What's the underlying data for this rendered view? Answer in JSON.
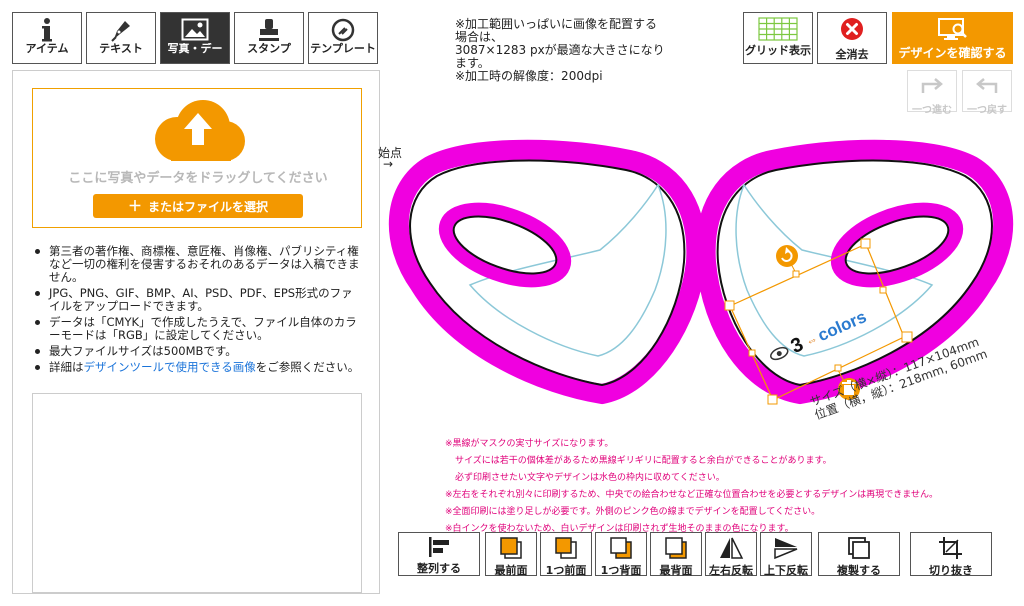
{
  "tabs": [
    {
      "label": "アイテム",
      "icon": "info-icon"
    },
    {
      "label": "テキスト",
      "icon": "pen-icon"
    },
    {
      "label": "写真・デー",
      "icon": "image-icon",
      "active": true
    },
    {
      "label": "スタンプ",
      "icon": "stamp-icon"
    },
    {
      "label": "テンプレート",
      "icon": "template-icon"
    }
  ],
  "upload": {
    "drop_text": "ここに写真やデータをドラッグしてください",
    "select_button": "またはファイルを選択"
  },
  "notes": [
    "第三者の著作権、商標権、意匠権、肖像権、パブリシティ権など一切の権利を侵害するおそれのあるデータは入稿できません。",
    "JPG、PNG、GIF、BMP、AI、PSD、PDF、EPS形式のファイルをアップロードできます。",
    "データは「CMYK」で作成したうえで、ファイル自体のカラーモードは「RGB」に設定してください。",
    "最大ファイルサイズは500MBです。"
  ],
  "note_link": {
    "prefix": "詳細は",
    "link": "デザインツールで使用できる画像",
    "suffix": "をご参照ください。"
  },
  "info": {
    "line1": "※加工範囲いっぱいに画像を配置する",
    "line2": "場合は、",
    "line3": "3087×1283 pxが最適な大きさになり",
    "line4": "ます。",
    "line5": "※加工時の解像度：200dpi"
  },
  "top_buttons": {
    "grid": "グリッド表示",
    "clear": "全消去",
    "confirm": "デザインを確認する",
    "redo": "一つ進む",
    "undo": "一つ戻す"
  },
  "canvas": {
    "start_label": "始点",
    "start_arrow": "→",
    "logo_text": "3",
    "logo_colors": "colors",
    "size_line": "サイズ（横×縦）：117×104mm",
    "position_line": "位置（横，縦）：218mm, 60mm"
  },
  "warnings": [
    "※黒線がマスクの実寸サイズになります。",
    "サイズには若干の個体差があるため黒線ギリギリに配置すると余白ができることがあります。",
    "必ず印刷させたい文字やデザインは水色の枠内に収めてください。",
    "※左右をそれぞれ別々に印刷するため、中央での絵合わせなど正確な位置合わせを必要とするデザインは再現できません。",
    "※全面印刷には塗り足しが必要です。外側のピンク色の線までデザインを配置してください。",
    "※白インクを使わないため、白いデザインは印刷されず生地そのままの色になります。"
  ],
  "bottom_buttons": [
    {
      "label": "整列する",
      "icon": "align-icon"
    },
    {
      "label": "最前面",
      "icon": "bring-front-icon"
    },
    {
      "label": "1つ前面",
      "icon": "bring-forward-icon"
    },
    {
      "label": "1つ背面",
      "icon": "send-backward-icon"
    },
    {
      "label": "最背面",
      "icon": "send-back-icon"
    },
    {
      "label": "左右反転",
      "icon": "flip-horizontal-icon"
    },
    {
      "label": "上下反転",
      "icon": "flip-vertical-icon"
    },
    {
      "label": "複製する",
      "icon": "duplicate-icon"
    },
    {
      "label": "切り抜き",
      "icon": "crop-icon"
    }
  ],
  "colors": {
    "accent": "#f39800",
    "bleed": "#f000e0",
    "safe": "#8cc8d8",
    "warning": "#e0007a",
    "clear": "#e02020"
  }
}
